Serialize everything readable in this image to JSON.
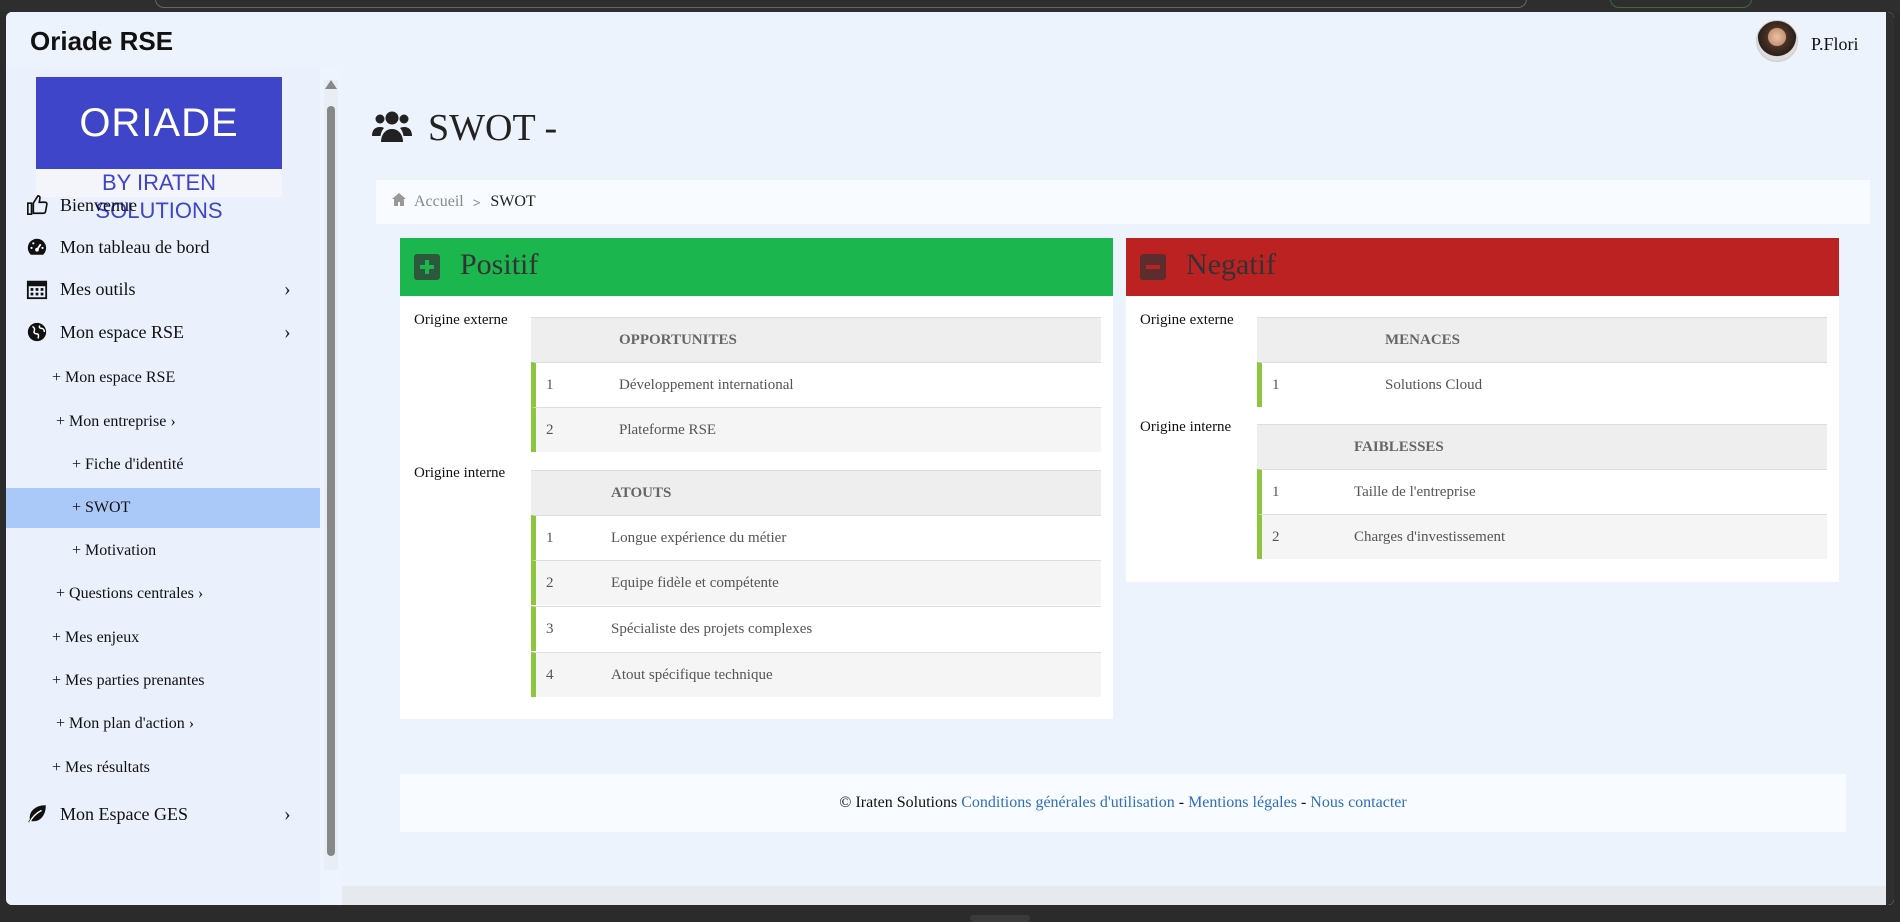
{
  "app": {
    "title": "Oriade RSE",
    "user": "P.Flori"
  },
  "logo": {
    "top_text": "ORIADE",
    "bottom_text": "BY IRATEN SOLUTIONS"
  },
  "sidebar": {
    "items": [
      {
        "label": "Bienvenue",
        "icon": "thumbs-up-icon"
      },
      {
        "label": "Mon tableau de bord",
        "icon": "dashboard-icon"
      },
      {
        "label": "Mes outils",
        "icon": "calendar-icon"
      },
      {
        "label": "Mon espace RSE",
        "icon": "globe-icon"
      }
    ],
    "subitems": [
      "+ Mon espace RSE",
      "+ Mon entreprise ›",
      "+ Fiche d'identité",
      "+ SWOT",
      "+ Motivation",
      "+ Questions centrales ›",
      "+ Mes enjeux",
      "+ Mes parties prenantes",
      "+ Mon plan d'action ›",
      "+ Mes résultats"
    ],
    "bottom_item": {
      "label": "Mon Espace GES",
      "icon": "leaf-icon"
    },
    "chevron": "›"
  },
  "page": {
    "title": "SWOT -"
  },
  "breadcrumb": {
    "home": "Accueil",
    "sep": ">",
    "current": "SWOT"
  },
  "positive": {
    "title": "Positif",
    "color": "#1cb64f",
    "origin_externe": "Origine externe",
    "origin_interne": "Origine interne",
    "opportunites": {
      "header": "OPPORTUNITES",
      "rows": [
        {
          "n": "1",
          "text": "Développement international"
        },
        {
          "n": "2",
          "text": "Plateforme RSE"
        }
      ]
    },
    "atouts": {
      "header": "ATOUTS",
      "rows": [
        {
          "n": "1",
          "text": "Longue expérience du métier"
        },
        {
          "n": "2",
          "text": "Equipe fidèle et compétente"
        },
        {
          "n": "3",
          "text": "Spécialiste des projets complexes"
        },
        {
          "n": "4",
          "text": "Atout spécifique technique"
        }
      ]
    }
  },
  "negative": {
    "title": "Negatif",
    "color": "#bd2222",
    "origin_externe": "Origine externe",
    "origin_interne": "Origine interne",
    "menaces": {
      "header": "MENACES",
      "rows": [
        {
          "n": "1",
          "text": "Solutions Cloud"
        }
      ]
    },
    "faiblesses": {
      "header": "FAIBLESSES",
      "rows": [
        {
          "n": "1",
          "text": "Taille de l'entreprise"
        },
        {
          "n": "2",
          "text": "Charges d'investissement"
        }
      ]
    }
  },
  "footer": {
    "copyright": "© Iraten Solutions",
    "link1": "Conditions générales d'utilisation",
    "sep": "-",
    "link2": "Mentions légales",
    "link3": "Nous contacter"
  }
}
